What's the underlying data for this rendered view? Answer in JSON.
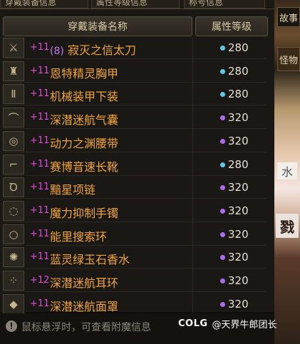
{
  "tabs": [
    "穿戴装备信息",
    "属性等级信息",
    "称号信息"
  ],
  "header": {
    "name_col": "穿戴装备名称",
    "level_col": "属性等级"
  },
  "items": [
    {
      "icon": "sword-icon",
      "plus": "+11",
      "prefix": "(8)",
      "name": "寂灭之信太刀",
      "level": "280",
      "dot": "#5fc7e8"
    },
    {
      "icon": "chest-armor-icon",
      "plus": "+11",
      "prefix": "",
      "name": "恩特精灵胸甲",
      "level": "280",
      "dot": "#5fc7e8"
    },
    {
      "icon": "pants-icon",
      "plus": "+11",
      "prefix": "",
      "name": "机械装甲下装",
      "level": "280",
      "dot": "#5fc7e8"
    },
    {
      "icon": "shoulder-icon",
      "plus": "+11",
      "prefix": "",
      "name": "深潜迷航气囊",
      "level": "320",
      "dot": "#b06af0"
    },
    {
      "icon": "belt-icon",
      "plus": "+11",
      "prefix": "",
      "name": "动力之渊腰带",
      "level": "320",
      "dot": "#b06af0"
    },
    {
      "icon": "boots-icon",
      "plus": "+11",
      "prefix": "",
      "name": "赛博音速长靴",
      "level": "280",
      "dot": "#5fc7e8"
    },
    {
      "icon": "necklace-icon",
      "plus": "+11",
      "prefix": "",
      "name": "黯星项链",
      "level": "320",
      "dot": "#b06af0"
    },
    {
      "icon": "bracelet-icon",
      "plus": "+11",
      "prefix": "",
      "name": "魔力抑制手镯",
      "level": "320",
      "dot": "#b06af0"
    },
    {
      "icon": "ring-icon",
      "plus": "+11",
      "prefix": "",
      "name": "能里搜索环",
      "level": "320",
      "dot": "#b06af0"
    },
    {
      "icon": "perfume-icon",
      "plus": "+11",
      "prefix": "",
      "name": "蓝灵绿玉石香水",
      "level": "320",
      "dot": "#b06af0"
    },
    {
      "icon": "earring-icon",
      "plus": "+12",
      "prefix": "",
      "name": "深潜迷航耳环",
      "level": "320",
      "dot": "#b06af0"
    },
    {
      "icon": "gem-icon",
      "plus": "+11",
      "prefix": "",
      "name": "深潜迷航面罩",
      "level": "320",
      "dot": "#b06af0"
    }
  ],
  "footer": {
    "hint": "鼠标悬浮时，可查看附魔信息"
  },
  "watermark": {
    "logo": "COLG",
    "text": "@天界牛郎团长"
  },
  "scene": {
    "tab1": "故事",
    "tab2": "怪物",
    "badge": "戮",
    "badge2": "水"
  }
}
